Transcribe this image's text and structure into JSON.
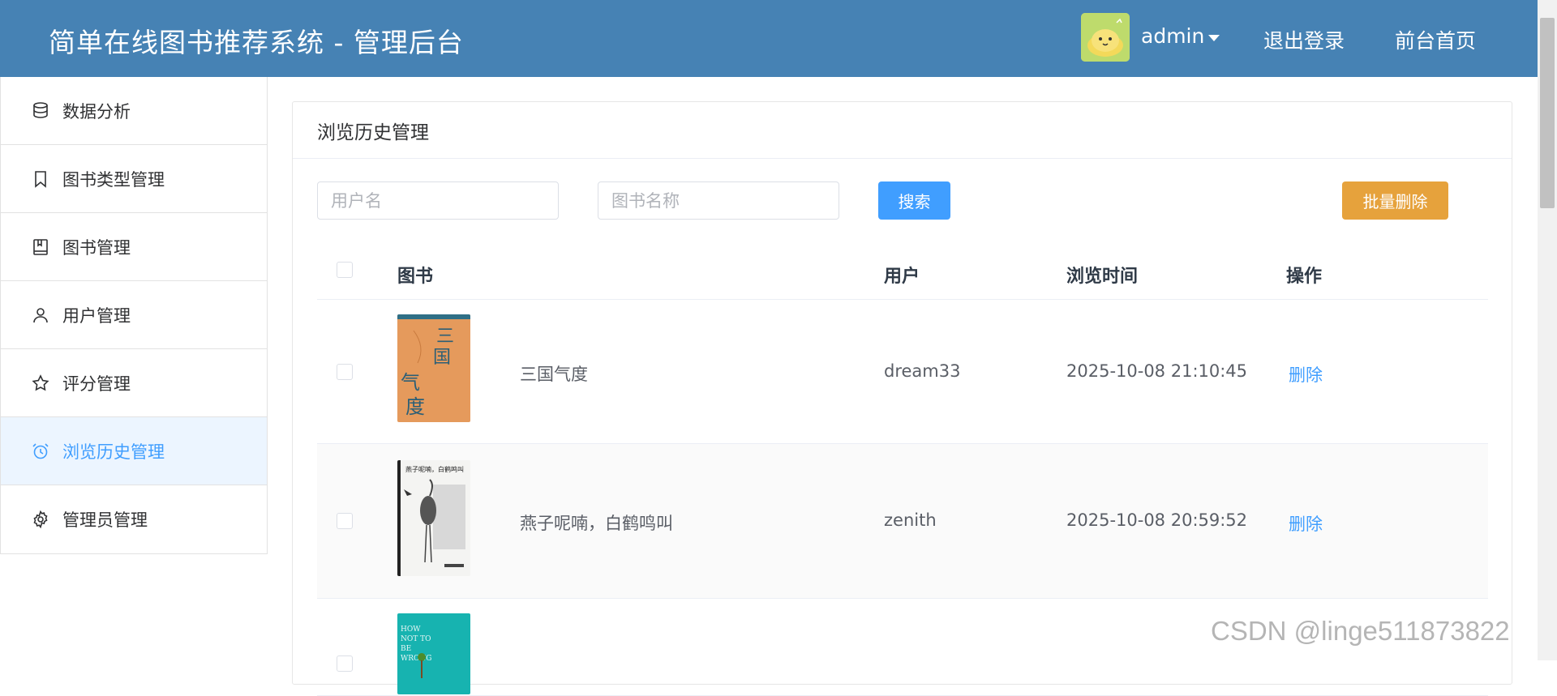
{
  "header": {
    "title": "简单在线图书推荐系统 - 管理后台",
    "user": "admin",
    "logout": "退出登录",
    "home": "前台首页"
  },
  "sidebar": {
    "items": [
      {
        "label": "数据分析",
        "icon": "database-icon"
      },
      {
        "label": "图书类型管理",
        "icon": "bookmark-icon"
      },
      {
        "label": "图书管理",
        "icon": "book-icon"
      },
      {
        "label": "用户管理",
        "icon": "user-icon"
      },
      {
        "label": "评分管理",
        "icon": "star-icon"
      },
      {
        "label": "浏览历史管理",
        "icon": "alarm-clock-icon",
        "active": true
      },
      {
        "label": "管理员管理",
        "icon": "gear-icon"
      }
    ]
  },
  "main": {
    "card_title": "浏览历史管理",
    "search": {
      "username_placeholder": "用户名",
      "bookname_placeholder": "图书名称",
      "search_label": "搜索",
      "batch_delete_label": "批量删除"
    },
    "table": {
      "columns": [
        "图书",
        "用户",
        "浏览时间",
        "操作"
      ],
      "rows": [
        {
          "title": "三国气度",
          "user": "dream33",
          "time": "2025-10-08 21:10:45",
          "action": "删除"
        },
        {
          "title": "燕子呢喃，白鹤鸣叫",
          "user": "zenith",
          "time": "2025-10-08 20:59:52",
          "action": "删除"
        },
        {
          "title": "",
          "user": "",
          "time": "",
          "action": ""
        }
      ]
    }
  },
  "watermark": "CSDN @linge511873822",
  "colors": {
    "header": "#4682b4",
    "primary": "#409eff",
    "warning": "#e6a23c",
    "active_bg": "#ecf5ff"
  }
}
